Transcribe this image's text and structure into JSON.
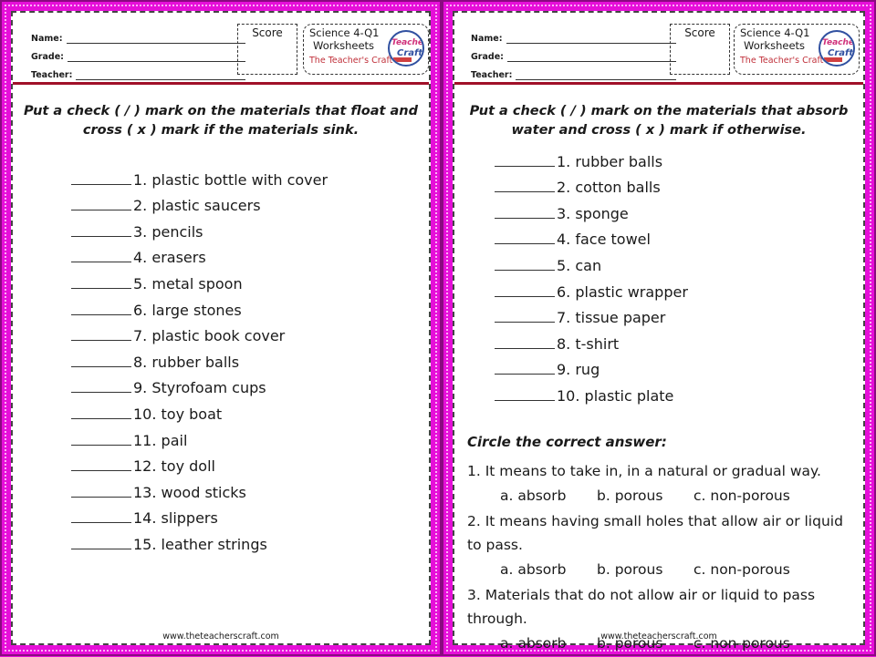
{
  "header": {
    "fields": [
      "Name:",
      "Grade:",
      "Teacher:"
    ],
    "score_label": "Score",
    "brand_title": "Science 4-Q1",
    "brand_subtitle": "Worksheets",
    "brand_credit": "The Teacher's Craft©",
    "logo_text_top": "Teacher's",
    "logo_text_bottom": "Craft"
  },
  "left": {
    "instruction_line1": "Put a check  ( / )   mark on the materials that float and",
    "instruction_line2": "cross  ( x )  mark if the materials sink.",
    "items": [
      "1. plastic bottle with cover",
      "2. plastic saucers",
      "3. pencils",
      "4. erasers",
      "5. metal spoon",
      "6. large stones",
      "7. plastic book cover",
      "8. rubber balls",
      "9. Styrofoam cups",
      "10. toy boat",
      "11. pail",
      "12. toy doll",
      "13. wood sticks",
      "14. slippers",
      "15. leather strings"
    ],
    "footer": "www.theteacherscraft.com"
  },
  "right": {
    "instruction_line1": "Put a check  ( / )   mark on the materials that absorb",
    "instruction_line2": "water and cross  ( x )  mark if otherwise.",
    "items": [
      "1. rubber balls",
      "2. cotton balls",
      "3. sponge",
      "4. face towel",
      "5. can",
      "6. plastic wrapper",
      "7. tissue paper",
      "8. t-shirt",
      "9. rug",
      "10. plastic plate"
    ],
    "circle_title": "Circle the correct answer:",
    "questions": [
      {
        "text": "1.  It means to take in, in a natural or gradual way.",
        "options": [
          "a. absorb",
          "b. porous",
          "c. non-porous"
        ]
      },
      {
        "text": "2. It means having small holes that allow air or liquid to pass.",
        "options": [
          "a. absorb",
          "b. porous",
          "c. non-porous"
        ]
      },
      {
        "text": "3. Materials that do not allow air or liquid to pass through.",
        "options": [
          "a. absorb",
          "b. porous",
          "c. non-porous"
        ]
      }
    ],
    "footer": "www.theteacherscraft.com"
  }
}
